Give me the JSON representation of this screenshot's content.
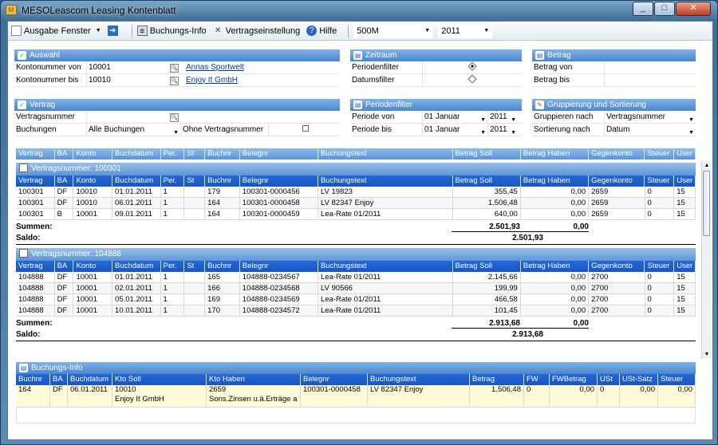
{
  "window": {
    "title": "MESOLeascom Leasing Kontenblatt",
    "buttons": [
      "_",
      "□",
      "✕"
    ]
  },
  "toolbar": {
    "ausgabe": "Ausgabe Fenster",
    "buchungsinfo": "Buchungs-Info",
    "vertragseinstellung": "Vertragseinstellung",
    "hilfe": "Hilfe",
    "mandant": "500M",
    "jahr": "2011"
  },
  "auswahl": {
    "title": "Auswahl",
    "kontonummer_von_label": "Kontonummer von",
    "kontonummer_von": "10001",
    "kontonummer_von_name": "Annas Sportwelt",
    "kontonummer_bis_label": "Kontonummer bis",
    "kontonummer_bis": "10010",
    "kontonummer_bis_name": "Enjoy It GmbH"
  },
  "zeitraum": {
    "title": "Zeitraum",
    "periodenfilter": "Periodenfilter",
    "datumsfilter": "Datumsfilter"
  },
  "betrag": {
    "title": "Betrag",
    "von": "Betrag von",
    "bis": "Betrag bis"
  },
  "vertrag": {
    "title": "Vertrag",
    "vertragsnummer_label": "Vertragsnummer",
    "buchungen_label": "Buchungen",
    "buchungen_value": "Alle Buchungen",
    "ohne_label": "Ohne Vertragsnummer"
  },
  "periodenfilter": {
    "title": "Periodenfilter",
    "von_label": "Periode von",
    "von_monat": "01 Januar",
    "von_jahr": "2011",
    "bis_label": "Periode bis",
    "bis_monat": "01 Januar",
    "bis_jahr": "2011"
  },
  "gruppierung": {
    "title": "Gruppierung und Sortierung",
    "gruppieren_label": "Gruppieren nach",
    "gruppieren_value": "Vertragsnummer",
    "sortierung_label": "Sortierung nach",
    "sortierung_value": "Datum"
  },
  "grid": {
    "columns": [
      "Vertrag",
      "BA",
      "Konto",
      "Buchdatum",
      "Per.",
      "St",
      "Buchnr",
      "Belegnr",
      "Buchungstext",
      "Betrag Soll",
      "Betrag Haben",
      "Gegenkonto",
      "Steuer",
      "User"
    ],
    "summen_label": "Summen:",
    "saldo_label": "Saldo:",
    "groups": [
      {
        "title": "Vertragsnummer: 100301",
        "rows": [
          [
            "100301",
            "DF",
            "10010",
            "01.01.2011",
            "1",
            "",
            "179",
            "100301-0000456",
            "LV 19823",
            "355,45",
            "0,00",
            "2659",
            "0",
            "15"
          ],
          [
            "100301",
            "DF",
            "10010",
            "06.01.2011",
            "1",
            "",
            "164",
            "100301-0000458",
            "LV 82347 Enjoy",
            "1.506,48",
            "0,00",
            "2659",
            "0",
            "15"
          ],
          [
            "100301",
            "B",
            "10001",
            "09.01.2011",
            "1",
            "",
            "164",
            "100301-0000459",
            "Lea-Rate 01/2011",
            "640,00",
            "0,00",
            "2659",
            "0",
            "15"
          ]
        ],
        "summe_soll": "2.501,93",
        "summe_haben": "0,00",
        "saldo": "2.501,93"
      },
      {
        "title": "Vertragsnummer: 104888",
        "rows": [
          [
            "104888",
            "DF",
            "10001",
            "01.01.2011",
            "1",
            "",
            "165",
            "104888-0234567",
            "Lea-Rate 01/2011",
            "2.145,66",
            "0,00",
            "2700",
            "0",
            "15"
          ],
          [
            "104888",
            "DF",
            "10001",
            "02.01.2011",
            "1",
            "",
            "166",
            "104888-0234568",
            "LV 90566",
            "199,99",
            "0,00",
            "2700",
            "0",
            "15"
          ],
          [
            "104888",
            "DF",
            "10001",
            "05.01.2011",
            "1",
            "",
            "169",
            "104888-0234569",
            "Lea-Rate 01/2011",
            "466,58",
            "0,00",
            "2700",
            "0",
            "15"
          ],
          [
            "104888",
            "DF",
            "10001",
            "10.01.2011",
            "1",
            "",
            "170",
            "104888-0234572",
            "Lea-Rate 01/2011",
            "101,45",
            "0,00",
            "2700",
            "0",
            "15"
          ]
        ],
        "summe_soll": "2.913,68",
        "summe_haben": "0,00",
        "saldo": "2.913,68"
      }
    ]
  },
  "buchungsinfo": {
    "title": "Buchungs-Info",
    "columns": [
      "Buchnr",
      "BA",
      "Buchdatum",
      "Kto Soll",
      "Kto Haben",
      "Belegnr",
      "Buchungstext",
      "Betrag",
      "FW",
      "FWBetrag",
      "USt",
      "USt-Satz",
      "Steuer"
    ],
    "row": {
      "buchnr": "164",
      "ba": "DF",
      "buchdatum": "06.01.2011",
      "kto_soll": "10010",
      "kto_soll_name": "Enjoy It GmbH",
      "kto_haben": "2659",
      "kto_haben_name": "Sons.Zinsen u.ä.Erträge a",
      "belegnr": "100301-0000458",
      "buchungstext": "LV 82347 Enjoy",
      "betrag": "1.506,48",
      "fw": "0",
      "fwbetrag": "0,00",
      "ust": "0",
      "ust_satz": "0,00",
      "steuer": "0,00"
    }
  }
}
